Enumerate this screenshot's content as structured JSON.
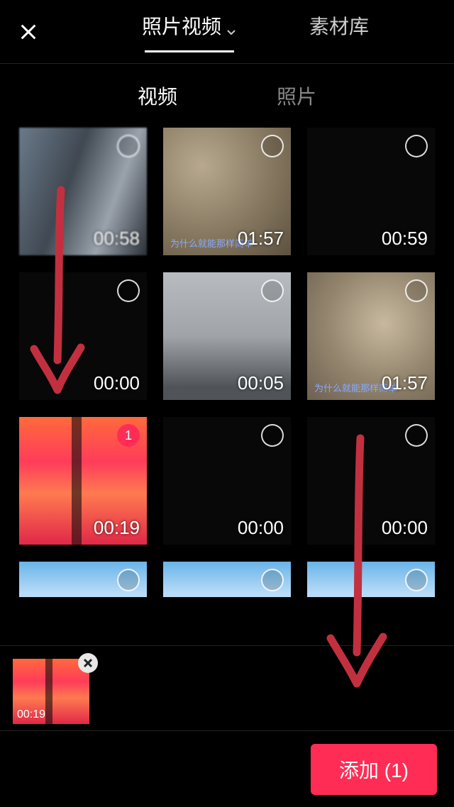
{
  "header": {
    "tabs": [
      {
        "label": "照片视频",
        "active": true,
        "hasDropdown": true
      },
      {
        "label": "素材库",
        "active": false,
        "hasDropdown": false
      }
    ]
  },
  "subtabs": [
    {
      "label": "视频",
      "active": true
    },
    {
      "label": "照片",
      "active": false
    }
  ],
  "grid": [
    {
      "duration": "00:58",
      "selected": false,
      "bg": "bg1",
      "caption": ""
    },
    {
      "duration": "01:57",
      "selected": false,
      "bg": "bg2",
      "caption": "为什么就能那样简单"
    },
    {
      "duration": "00:59",
      "selected": false,
      "bg": "bg3",
      "caption": ""
    },
    {
      "duration": "00:00",
      "selected": false,
      "bg": "bg4",
      "caption": ""
    },
    {
      "duration": "00:05",
      "selected": false,
      "bg": "bg5",
      "caption": ""
    },
    {
      "duration": "01:57",
      "selected": false,
      "bg": "bg6",
      "caption": "为什么就能那样简单"
    },
    {
      "duration": "00:19",
      "selected": true,
      "selectedIndex": "1",
      "bg": "bg7",
      "caption": ""
    },
    {
      "duration": "00:00",
      "selected": false,
      "bg": "bg8",
      "caption": ""
    },
    {
      "duration": "00:00",
      "selected": false,
      "bg": "bg9",
      "caption": ""
    },
    {
      "duration": "",
      "selected": false,
      "bg": "bg10",
      "caption": "",
      "partial": true
    },
    {
      "duration": "",
      "selected": false,
      "bg": "bg11",
      "caption": "",
      "partial": true
    },
    {
      "duration": "",
      "selected": false,
      "bg": "bg12",
      "caption": "",
      "partial": true
    }
  ],
  "tray": [
    {
      "duration": "00:19"
    }
  ],
  "footer": {
    "addButton": "添加 (1)"
  },
  "annotation": {
    "color": "#c23040"
  }
}
